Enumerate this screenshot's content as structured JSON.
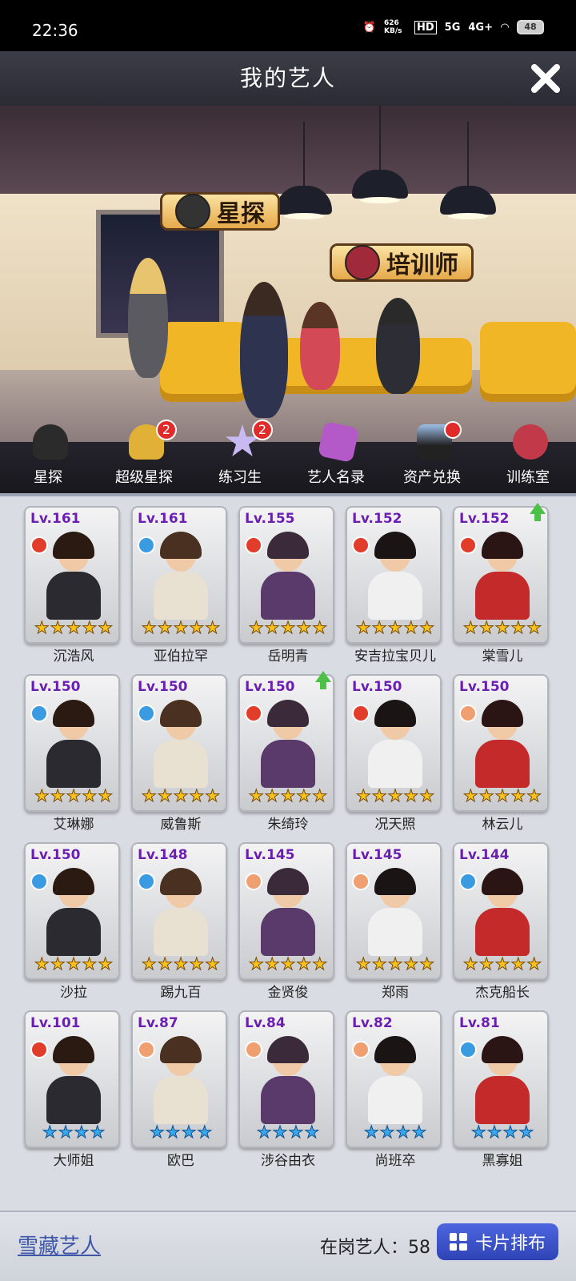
{
  "status_bar": {
    "time": "22:36",
    "net_speed": "626 KB/s",
    "hd": "HD",
    "sim1": "5G",
    "sim2": "4G+",
    "battery": "48"
  },
  "header": {
    "title": "我的艺人"
  },
  "scene": {
    "banners": {
      "scout": "星探",
      "trainer": "培训师"
    }
  },
  "toolbar": {
    "items": [
      {
        "label": "星探",
        "icon": "hat-icon",
        "badge": null
      },
      {
        "label": "超级星探",
        "icon": "gold-hat-icon",
        "badge": "2"
      },
      {
        "label": "练习生",
        "icon": "star-icon",
        "badge": "2"
      },
      {
        "label": "艺人名录",
        "icon": "book-icon",
        "badge": null
      },
      {
        "label": "资产兑换",
        "icon": "silhouette-icon",
        "badge": "dot"
      },
      {
        "label": "训练室",
        "icon": "dumbbell-icon",
        "badge": null
      }
    ]
  },
  "artists": [
    {
      "level": "Lv.161",
      "name": "沉浩风",
      "stars": 5,
      "star_color": "gold",
      "type": "red",
      "arrow": false
    },
    {
      "level": "Lv.161",
      "name": "亚伯拉罕",
      "stars": 5,
      "star_color": "gold",
      "type": "blue",
      "arrow": false
    },
    {
      "level": "Lv.155",
      "name": "岳明青",
      "stars": 5,
      "star_color": "gold",
      "type": "red",
      "arrow": false
    },
    {
      "level": "Lv.152",
      "name": "安吉拉宝贝儿",
      "stars": 5,
      "star_color": "gold",
      "type": "red",
      "arrow": false
    },
    {
      "level": "Lv.152",
      "name": "棠雪儿",
      "stars": 5,
      "star_color": "gold",
      "type": "red",
      "arrow": true
    },
    {
      "level": "Lv.150",
      "name": "艾琳娜",
      "stars": 5,
      "star_color": "gold",
      "type": "blue",
      "arrow": false
    },
    {
      "level": "Lv.150",
      "name": "威鲁斯",
      "stars": 5,
      "star_color": "gold",
      "type": "blue",
      "arrow": false
    },
    {
      "level": "Lv.150",
      "name": "朱绮玲",
      "stars": 5,
      "star_color": "gold",
      "type": "red",
      "arrow": true
    },
    {
      "level": "Lv.150",
      "name": "况天照",
      "stars": 5,
      "star_color": "gold",
      "type": "red",
      "arrow": false
    },
    {
      "level": "Lv.150",
      "name": "林云儿",
      "stars": 5,
      "star_color": "gold",
      "type": "orange",
      "arrow": false
    },
    {
      "level": "Lv.150",
      "name": "沙拉",
      "stars": 5,
      "star_color": "gold",
      "type": "blue",
      "arrow": false
    },
    {
      "level": "Lv.148",
      "name": "踢九百",
      "stars": 5,
      "star_color": "gold",
      "type": "blue",
      "arrow": false
    },
    {
      "level": "Lv.145",
      "name": "金贤俊",
      "stars": 5,
      "star_color": "gold",
      "type": "orange",
      "arrow": false
    },
    {
      "level": "Lv.145",
      "name": "郑雨",
      "stars": 5,
      "star_color": "gold",
      "type": "orange",
      "arrow": false
    },
    {
      "level": "Lv.144",
      "name": "杰克船长",
      "stars": 5,
      "star_color": "gold",
      "type": "blue",
      "arrow": false
    },
    {
      "level": "Lv.101",
      "name": "大师姐",
      "stars": 4,
      "star_color": "blue",
      "type": "red",
      "arrow": false
    },
    {
      "level": "Lv.87",
      "name": "欧巴",
      "stars": 4,
      "star_color": "blue",
      "type": "orange",
      "arrow": false
    },
    {
      "level": "Lv.84",
      "name": "涉谷由衣",
      "stars": 4,
      "star_color": "blue",
      "type": "orange",
      "arrow": false
    },
    {
      "level": "Lv.82",
      "name": "尚班卒",
      "stars": 4,
      "star_color": "blue",
      "type": "orange",
      "arrow": false
    },
    {
      "level": "Lv.81",
      "name": "黑寡姐",
      "stars": 4,
      "star_color": "blue",
      "type": "blue",
      "arrow": false
    }
  ],
  "footer": {
    "hidden_artists_label": "雪藏艺人",
    "on_duty_label": "在岗艺人：",
    "on_duty_count": "58",
    "sort_button_label": "卡片排布"
  },
  "colors": {
    "type_red": "#e23c2a",
    "type_blue": "#3a9be0",
    "type_orange": "#f0a070",
    "level_text": "#6a1fb0",
    "sort_button": "#3a52c8"
  }
}
